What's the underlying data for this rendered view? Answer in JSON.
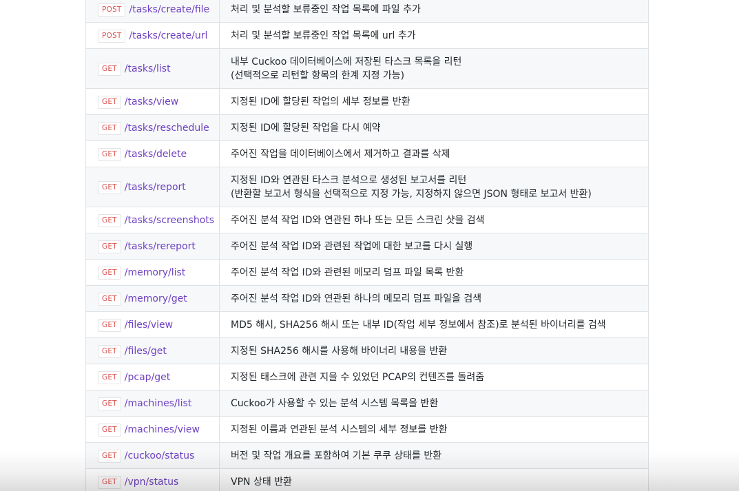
{
  "colors": {
    "method_text": "#d9534f",
    "path_text": "#6f42c1",
    "desc_text": "#24292e",
    "border": "#dfe2e5",
    "row_stripe": "#f6f8fa"
  },
  "rows": [
    {
      "method": "POST",
      "path": "/tasks/create/file",
      "desc": [
        "처리 및 분석할 보류중인 작업 목록에 파일 추가"
      ]
    },
    {
      "method": "POST",
      "path": "/tasks/create/url",
      "desc": [
        "처리 및 분석할 보류중인 작업 목록에 url 추가"
      ]
    },
    {
      "method": "GET",
      "path": "/tasks/list",
      "desc": [
        "내부 Cuckoo 데이터베이스에 저장된 타스크 목록을 리턴",
        "(선택적으로 리턴할 항목의 한계 지정 가능)"
      ]
    },
    {
      "method": "GET",
      "path": "/tasks/view",
      "desc": [
        "지정된 ID에 할당된 작업의 세부 정보를 반환"
      ]
    },
    {
      "method": "GET",
      "path": "/tasks/reschedule",
      "desc": [
        "지정된 ID에 할당된 작업을 다시 예약"
      ]
    },
    {
      "method": "GET",
      "path": "/tasks/delete",
      "desc": [
        "주어진 작업을 데이터베이스에서 제거하고 결과를 삭제"
      ]
    },
    {
      "method": "GET",
      "path": "/tasks/report",
      "desc": [
        "지정된 ID와 연관된 타스크 분석으로 생성된 보고서를 리턴",
        "(반환할 보고서 형식을 선택적으로 지정 가능, 지정하지 않으면 JSON 형태로 보고서 반환)"
      ]
    },
    {
      "method": "GET",
      "path": "/tasks/screenshots",
      "desc": [
        "주어진 분석 작업 ID와 연관된 하나 또는 모든 스크린 샷을 검색"
      ]
    },
    {
      "method": "GET",
      "path": "/tasks/rereport",
      "desc": [
        "주어진 분석 작업 ID와 관련된 작업에 대한 보고를 다시 실행"
      ]
    },
    {
      "method": "GET",
      "path": "/memory/list",
      "desc": [
        "주어진 분석 작업 ID와 관련된 메모리 덤프 파일 목록 반환"
      ]
    },
    {
      "method": "GET",
      "path": "/memory/get",
      "desc": [
        "주어진 분석 작업 ID와 연관된 하나의 메모리 덤프 파일을 검색"
      ]
    },
    {
      "method": "GET",
      "path": "/files/view",
      "desc": [
        "MD5 해시, SHA256 해시 또는 내부 ID(작업 세부 정보에서 참조)로 분석된 바이너리를 검색"
      ]
    },
    {
      "method": "GET",
      "path": "/files/get",
      "desc": [
        "지정된 SHA256 해시를 사용해 바이너리 내용을 반환"
      ]
    },
    {
      "method": "GET",
      "path": "/pcap/get",
      "desc": [
        "지정된 태스크에 관련 지을 수 있었던 PCAP의 컨텐즈를 돌려줌"
      ]
    },
    {
      "method": "GET",
      "path": "/machines/list",
      "desc": [
        "Cuckoo가 사용할 수 있는 분석 시스템 목록을 반환"
      ]
    },
    {
      "method": "GET",
      "path": "/machines/view",
      "desc": [
        "지정된 이름과 연관된 분석 시스템의 세부 정보를 반환"
      ]
    },
    {
      "method": "GET",
      "path": "/cuckoo/status",
      "desc": [
        "버전 및 작업 개요를 포함하여 기본 쿠쿠 상태를 반환"
      ]
    },
    {
      "method": "GET",
      "path": "/vpn/status",
      "desc": [
        "VPN 상태 반환"
      ]
    }
  ]
}
